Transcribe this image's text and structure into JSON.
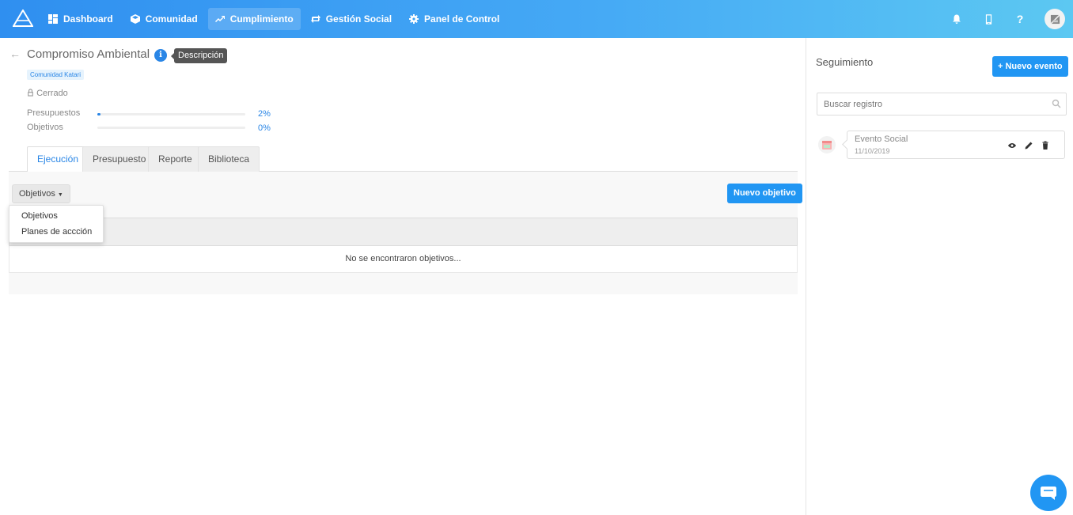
{
  "nav": {
    "items": [
      {
        "label": "Dashboard",
        "icon": "dashboard-icon"
      },
      {
        "label": "Comunidad",
        "icon": "cube-icon"
      },
      {
        "label": "Cumplimiento",
        "icon": "trending-up-icon",
        "active": true
      },
      {
        "label": "Gestión Social",
        "icon": "swap-icon"
      },
      {
        "label": "Panel de Control",
        "icon": "gear-icon"
      }
    ],
    "help_label": "?"
  },
  "page": {
    "title": "Compromiso Ambiental",
    "info_icon_glyph": "i",
    "tooltip": "Descripción",
    "tag": "Comunidad Katari",
    "status": "Cerrado",
    "progress": [
      {
        "label": "Presupuestos",
        "value_text": "2%",
        "percent": 2
      },
      {
        "label": "Objetivos",
        "value_text": "0%",
        "percent": 0
      }
    ]
  },
  "tabs": [
    "Ejecución",
    "Presupuesto",
    "Reporte",
    "Biblioteca"
  ],
  "toolbar": {
    "dropdown_label": "Objetivos",
    "new_button": "Nuevo objetivo"
  },
  "dropdown_menu": [
    "Objetivos",
    "Planes de accción"
  ],
  "table": {
    "empty_message": "No se encontraron objetivos..."
  },
  "right_panel": {
    "title": "Seguimiento",
    "new_event_button": "+ Nuevo evento",
    "search_placeholder": "Buscar registro",
    "events": [
      {
        "title": "Evento Social",
        "date": "11/10/2019"
      }
    ]
  },
  "colors": {
    "primary": "#2196f3",
    "accent_blue": "#2a86e6",
    "nav_gradient_start": "#2f8ff0",
    "nav_gradient_end": "#5cc8f2"
  }
}
